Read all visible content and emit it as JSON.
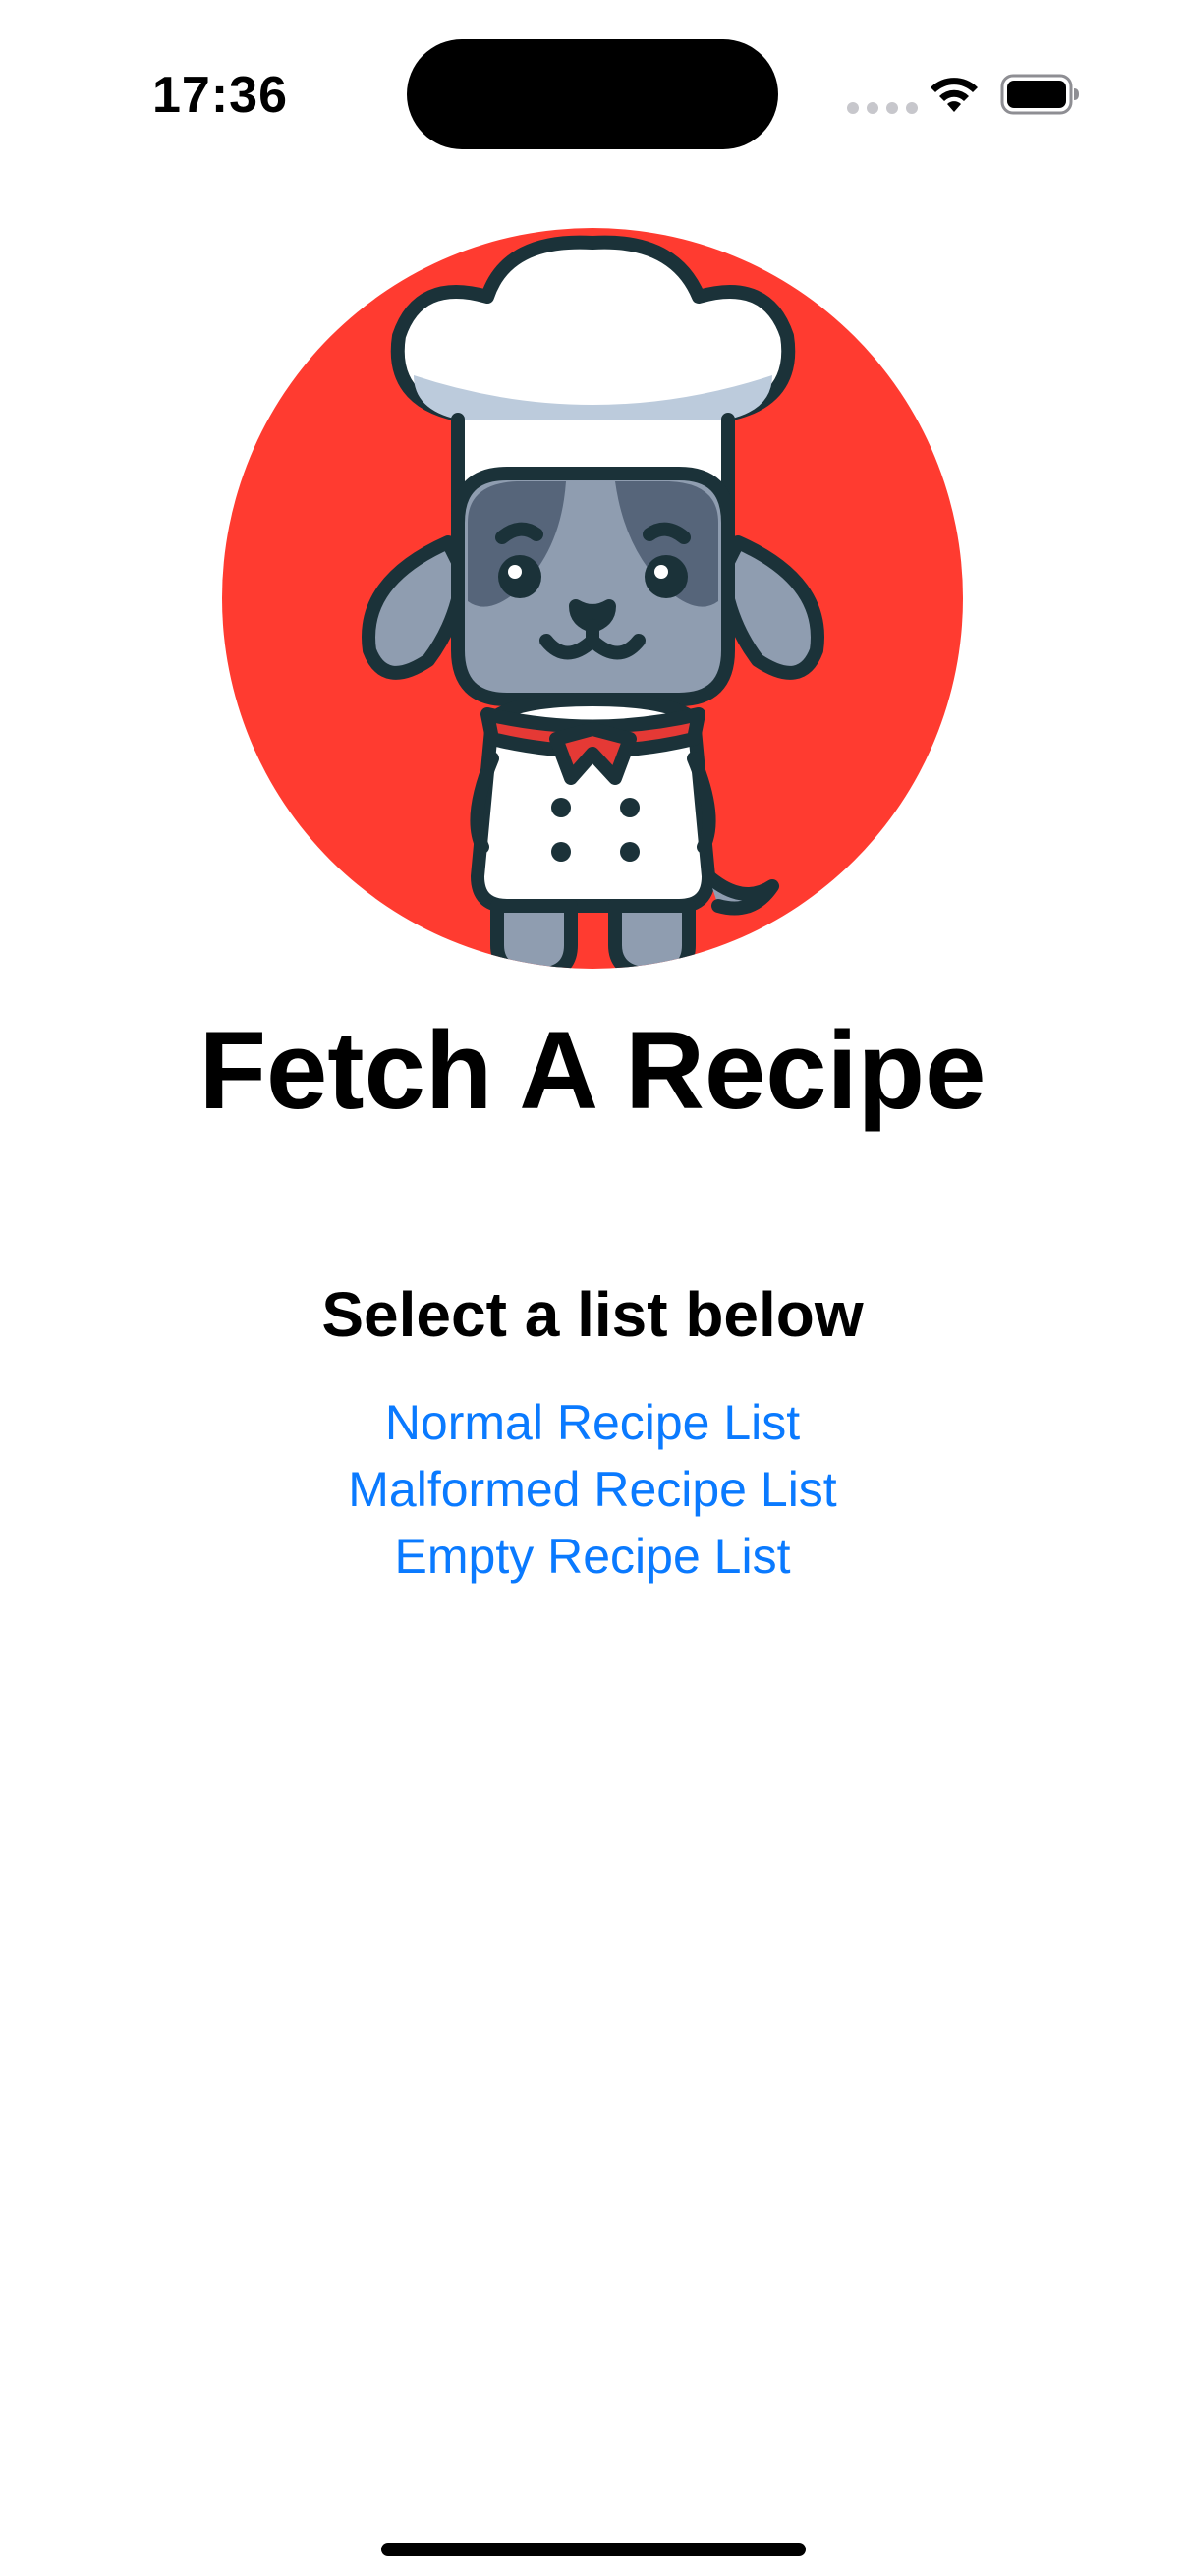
{
  "status_bar": {
    "time": "17:36",
    "icons": [
      "signal-dots-icon",
      "wifi-icon",
      "battery-icon"
    ]
  },
  "logo": {
    "description_icon": "chef-dog-logo-icon",
    "background_color": "#ff3b30"
  },
  "main": {
    "title": "Fetch A Recipe",
    "subtitle": "Select a list below",
    "links": [
      {
        "label": "Normal Recipe List"
      },
      {
        "label": "Malformed Recipe List"
      },
      {
        "label": "Empty Recipe List"
      }
    ],
    "link_color": "#0a7aff"
  }
}
